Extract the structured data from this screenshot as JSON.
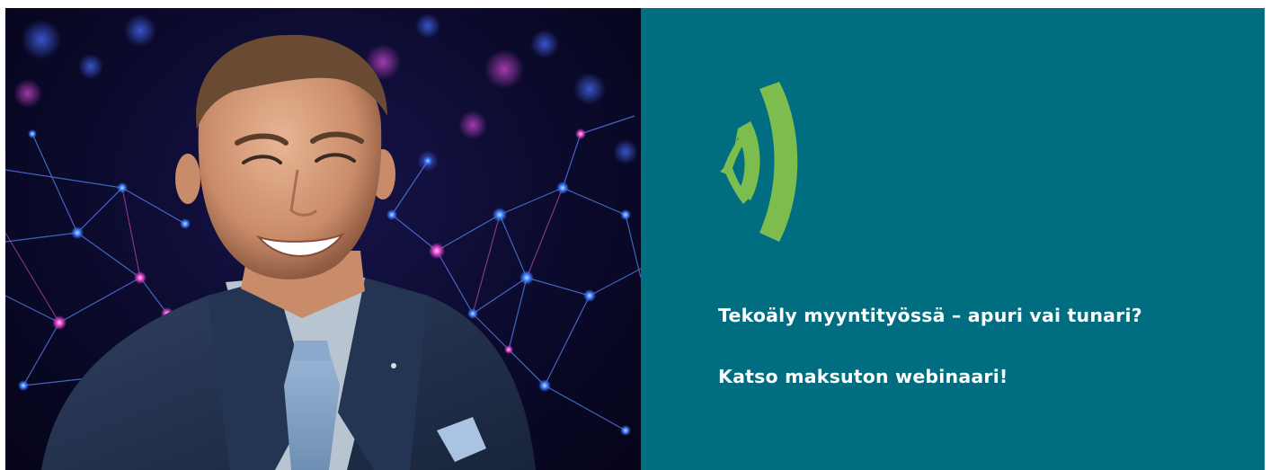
{
  "banner": {
    "headline": "Tekoäly myyntityössä – apuri vai tunari?",
    "cta": "Katso maksuton webinaari!",
    "photo_subject": "presenter-portrait",
    "colors": {
      "panel_background": "#006d80",
      "brand_green": "#7dbd4f",
      "text": "#ffffff",
      "network_blue": "#3a86ff",
      "network_pink": "#e040c8"
    },
    "icons": [
      "signal-waves-icon"
    ]
  }
}
